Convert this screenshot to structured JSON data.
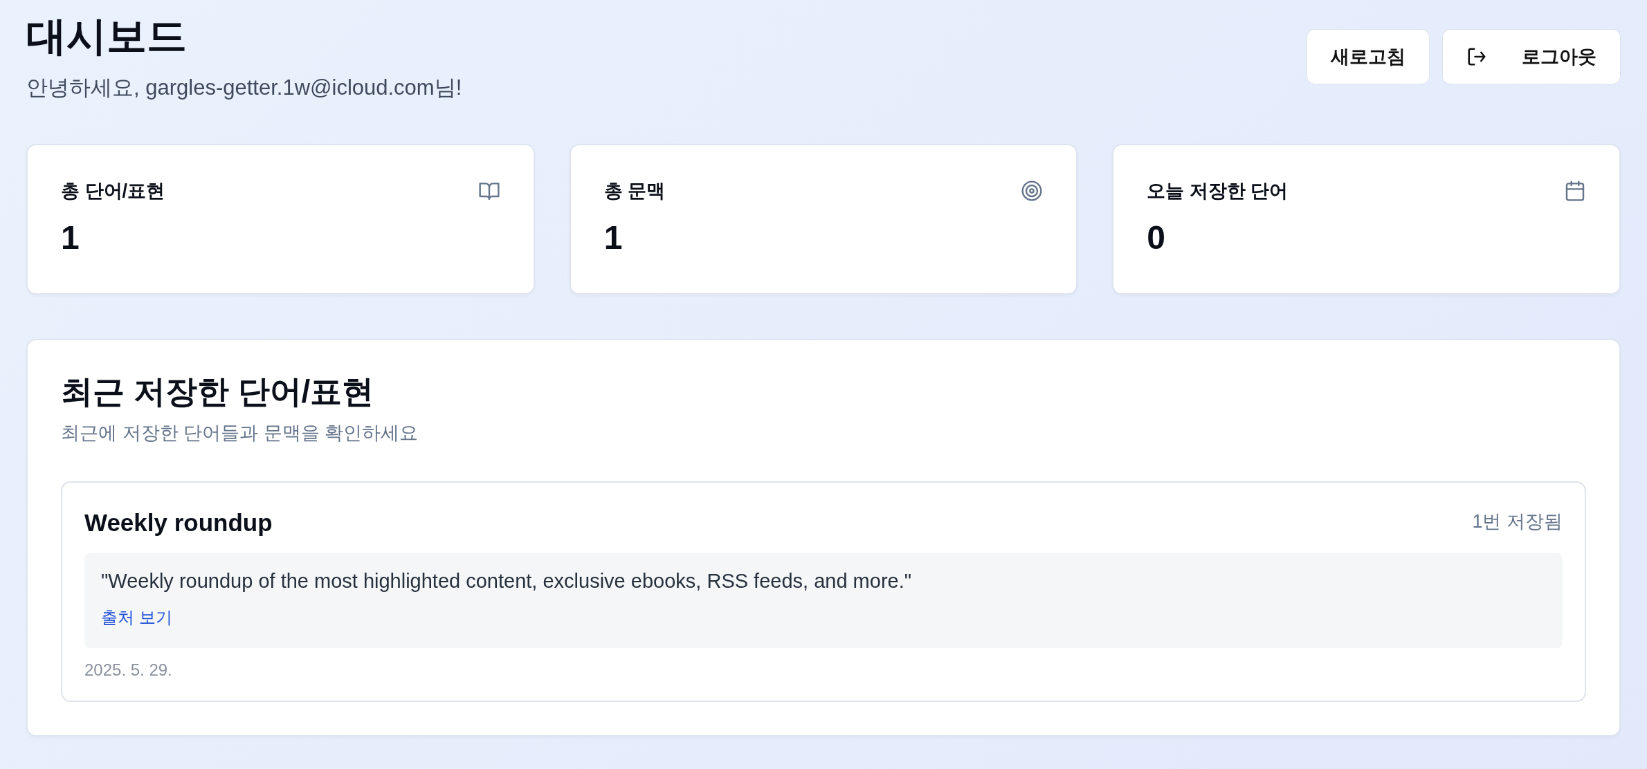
{
  "header": {
    "title": "대시보드",
    "greeting": "안녕하세요, gargles-getter.1w@icloud.com님!"
  },
  "buttons": [
    {
      "label": "새로고침",
      "kind": "plain"
    },
    {
      "label": "로그아웃",
      "kind": "logout"
    }
  ],
  "stats": [
    {
      "label": "총 단어/표현",
      "value": "1",
      "kind": "book"
    },
    {
      "label": "총 문맥",
      "value": "1",
      "kind": "target"
    },
    {
      "label": "오늘 저장한 단어",
      "value": "0",
      "kind": "calendar"
    }
  ],
  "recent": {
    "title": "최근 저장한 단어/표현",
    "subtitle": "최근에 저장한 단어들과 문맥을 확인하세요",
    "items": [
      {
        "word": "Weekly roundup",
        "count": "1번 저장됨",
        "context": "\"Weekly roundup of the most highlighted content, exclusive ebooks, RSS feeds, and more.\"",
        "link": "출처 보기",
        "date": "2025. 5. 29."
      }
    ]
  }
}
